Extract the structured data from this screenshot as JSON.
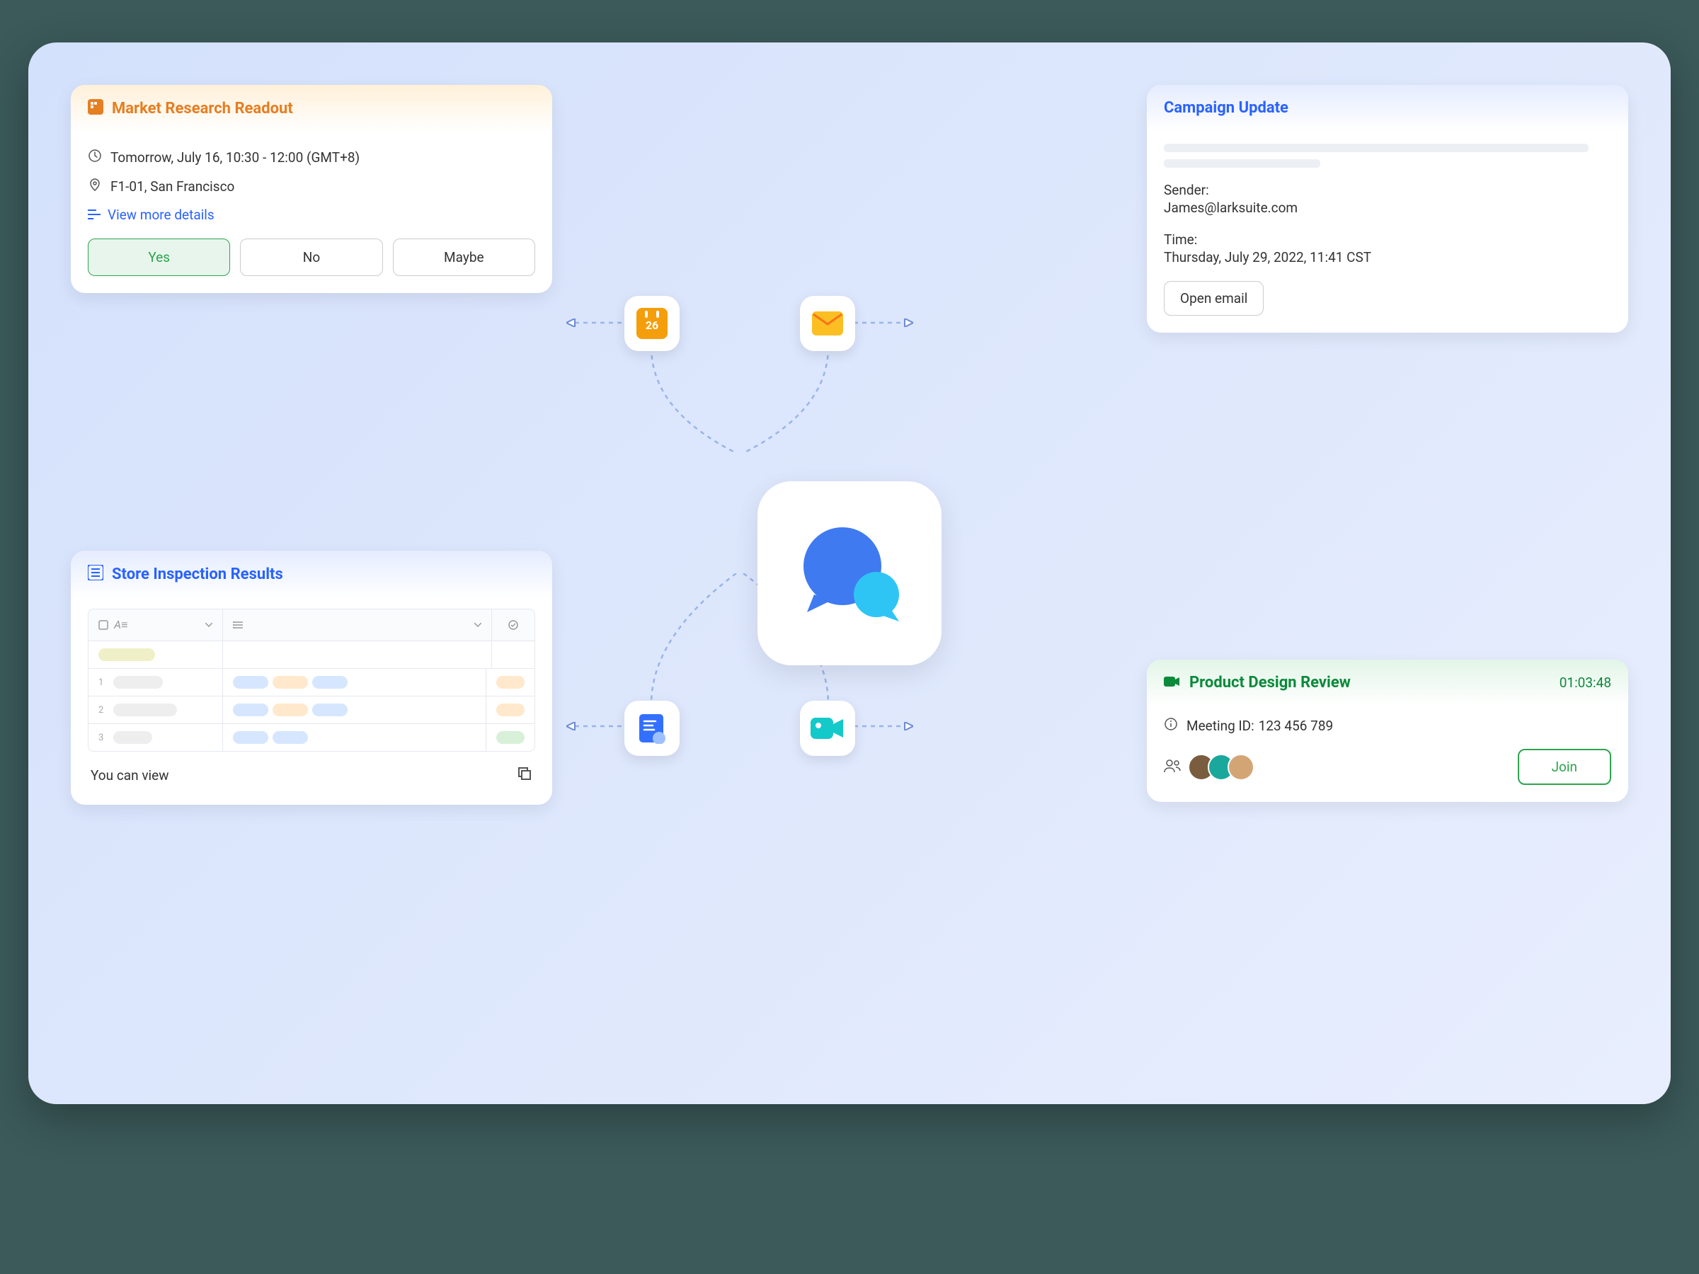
{
  "calendar": {
    "title": "Market Research Readout",
    "time": "Tomorrow, July 16, 10:30 - 12:00 (GMT+8)",
    "location": "F1-01, San Francisco",
    "view_more": "View more details",
    "buttons": {
      "yes": "Yes",
      "no": "No",
      "maybe": "Maybe"
    }
  },
  "store": {
    "title": "Store Inspection Results",
    "footer": "You can view"
  },
  "email": {
    "title": "Campaign Update",
    "sender_label": "Sender:",
    "sender": "James@larksuite.com",
    "time_label": "Time:",
    "time": "Thursday, July 29, 2022, 11:41 CST",
    "open": "Open email"
  },
  "video": {
    "title": "Product Design Review",
    "timer": "01:03:48",
    "meeting_id_label": "Meeting ID:",
    "meeting_id": "123 456 789",
    "join": "Join"
  },
  "center_icon": {
    "calendar_day": "26"
  }
}
